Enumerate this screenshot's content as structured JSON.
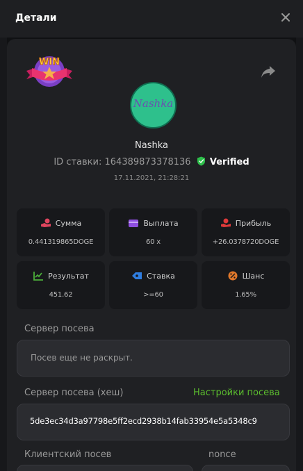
{
  "modal": {
    "title": "Детали"
  },
  "player": {
    "username": "Nashka",
    "avatar_text": "Nashka"
  },
  "bet": {
    "id_label": "ID ставки:",
    "id_value": "164389873378136",
    "verified_label": "Verified",
    "datetime": "17.11.2021, 21:28:21"
  },
  "badge": {
    "text": "WIN"
  },
  "stats": [
    {
      "label": "Сумма",
      "value": "0.441319865DOGE",
      "icon": "coins-hand-icon",
      "color": "#e0455e"
    },
    {
      "label": "Выплата",
      "value": "60 x",
      "icon": "wallet-icon",
      "color": "#8f4fe0"
    },
    {
      "label": "Прибыль",
      "value": "+26.0378720DOGE",
      "icon": "profit-hand-icon",
      "color": "#e03a3a"
    },
    {
      "label": "Результат",
      "value": "451.62",
      "icon": "result-chart-icon",
      "color": "#4caf3a"
    },
    {
      "label": "Ставка",
      "value": ">=60",
      "icon": "bet-tag-icon",
      "color": "#2f7de0"
    },
    {
      "label": "Шанс",
      "value": "1.65%",
      "icon": "percent-icon",
      "color": "#e0782b"
    }
  ],
  "seed": {
    "server_label": "Сервер посева",
    "server_value": "Посев еще не раскрыт.",
    "server_hash_label": "Сервер посева (хеш)",
    "settings_link": "Настройки посева",
    "server_hash_value": "5de3ec34d3a97798e5ff2ecd2938b14fab33954e5a5348c9",
    "client_label": "Клиентский посев",
    "nonce_label": "nonce"
  },
  "colors": {
    "accent_green": "#5bbd2e",
    "verified_green": "#2dbe4a",
    "panel_bg": "#1f2023",
    "card_bg": "#17181b"
  }
}
